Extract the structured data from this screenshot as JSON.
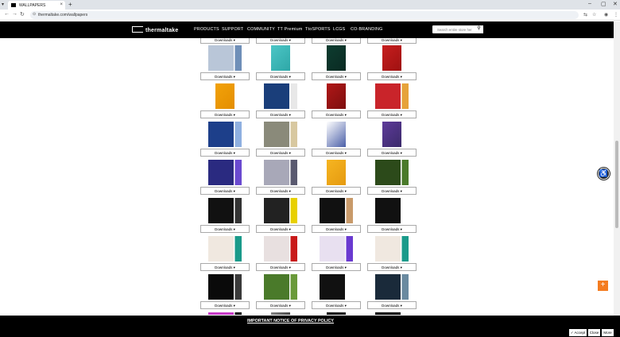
{
  "browser": {
    "tab_title": "WALLPAPERS",
    "tab_close": "×",
    "new_tab": "+",
    "url": "thermaltake.com/wallpapers"
  },
  "site": {
    "logo_text": "thermaltake",
    "nav": [
      "PRODUCTS",
      "SUPPORT",
      "COMMUNITY",
      "TT Premium",
      "TtoSPORTS",
      "LCGS",
      "CO-BRANDING"
    ],
    "search_placeholder": "Search entire store her"
  },
  "download_label": "Downloads ▾",
  "wallpaper_rows": [
    [
      {
        "colors": [
          "#b9c6d8",
          "#6f8fb8"
        ],
        "split": true
      },
      {
        "colors": [
          "#4cc6c6",
          "#2ea7a7"
        ],
        "split": false
      },
      {
        "colors": [
          "#0d3d30",
          "#0a2a22"
        ],
        "split": false
      },
      {
        "colors": [
          "#c71e1e",
          "#9e1111"
        ],
        "split": false
      }
    ],
    [
      {
        "colors": [
          "#f2a20a",
          "#e48e00"
        ],
        "split": false
      },
      {
        "colors": [
          "#1a3e7a",
          "#e8e8e8"
        ],
        "split": true
      },
      {
        "colors": [
          "#b01818",
          "#7d0e0e"
        ],
        "split": false
      },
      {
        "colors": [
          "#c9242a",
          "#e6a33a"
        ],
        "split": true
      }
    ],
    [
      {
        "colors": [
          "#1d3f8a",
          "#8fb0e0"
        ],
        "split": true
      },
      {
        "colors": [
          "#8a8a7a",
          "#d8c8a0"
        ],
        "split": true
      },
      {
        "colors": [
          "#ffffff",
          "#4a5fa8"
        ],
        "split": false
      },
      {
        "colors": [
          "#5e3b9a",
          "#3b2a6a"
        ],
        "split": false
      }
    ],
    [
      {
        "colors": [
          "#2a2a80",
          "#6a4ad0"
        ],
        "split": true
      },
      {
        "colors": [
          "#a8a8b8",
          "#5a5a70"
        ],
        "split": true
      },
      {
        "colors": [
          "#f6b521",
          "#e59a10"
        ],
        "split": false
      },
      {
        "colors": [
          "#2c4a1a",
          "#4a7a2a"
        ],
        "split": true
      }
    ],
    [
      {
        "colors": [
          "#111111",
          "#333333"
        ],
        "split": true
      },
      {
        "colors": [
          "#222222",
          "#e8d000"
        ],
        "split": true
      },
      {
        "colors": [
          "#111111",
          "#c89a6a"
        ],
        "split": true
      },
      {
        "colors": [
          "#111111",
          "#ffffff"
        ],
        "split": true
      }
    ],
    [
      {
        "colors": [
          "#f0e8e0",
          "#1a9a8a"
        ],
        "split": true
      },
      {
        "colors": [
          "#e8e0e0",
          "#c81a1a"
        ],
        "split": true
      },
      {
        "colors": [
          "#e8e0f0",
          "#6a3ad0"
        ],
        "split": true
      },
      {
        "colors": [
          "#f0e8e0",
          "#1a9a8a"
        ],
        "split": true
      }
    ],
    [
      {
        "colors": [
          "#0a0a0a",
          "#3a3a3a"
        ],
        "split": true
      },
      {
        "colors": [
          "#4a7a2a",
          "#6a9a3a"
        ],
        "split": true
      },
      {
        "colors": [
          "#111111",
          "#ffffff"
        ],
        "split": true
      },
      {
        "colors": [
          "#1a2a3a",
          "#6a8aa0"
        ],
        "split": true
      }
    ],
    [
      {
        "colors": [
          "#c83ac8",
          "#000000"
        ],
        "split": true
      },
      {
        "colors": [
          "#888888",
          "#000000"
        ],
        "split": false
      },
      {
        "colors": [
          "#000000",
          "#444444"
        ],
        "split": false
      },
      {
        "colors": [
          "#000000",
          "#ffffff"
        ],
        "split": true
      }
    ]
  ],
  "privacy": {
    "title": "IMPORTANT NOTICE OF PRIVACY POLICY",
    "accept": "✓ Accept",
    "close": "Close",
    "more": "More"
  }
}
